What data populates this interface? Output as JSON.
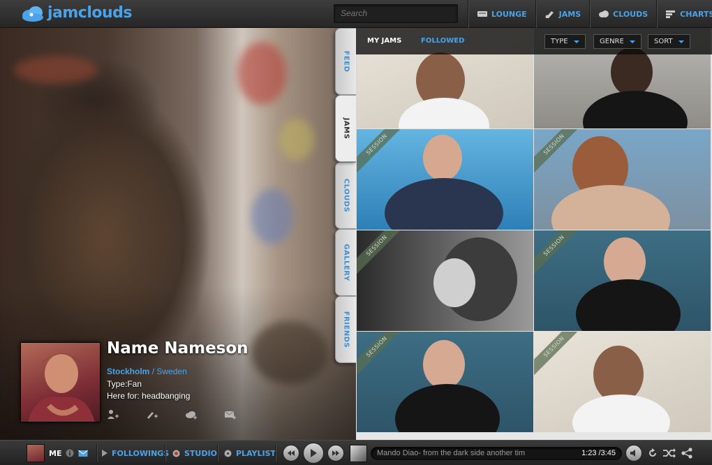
{
  "app": {
    "brand": "jamclouds"
  },
  "search": {
    "placeholder": "Search"
  },
  "nav": [
    {
      "label": "LOUNGE",
      "icon": "lounge-icon"
    },
    {
      "label": "JAMS",
      "icon": "jams-icon"
    },
    {
      "label": "CLOUDS",
      "icon": "cloud-icon"
    },
    {
      "label": "CHARTS",
      "icon": "charts-icon"
    }
  ],
  "profile": {
    "name": "Name Nameson",
    "city": "Stockholm",
    "separator": "/",
    "country": "Sweden",
    "type": "Type:Fan",
    "here_for": "Here for: headbanging"
  },
  "side_tabs": [
    {
      "label": "FEED",
      "active": false
    },
    {
      "label": "JAMS",
      "active": true
    },
    {
      "label": "CLOUDS",
      "active": false
    },
    {
      "label": "GALLERY",
      "active": false
    },
    {
      "label": "FRIENDS",
      "active": false
    }
  ],
  "subnav": {
    "my_jams": "MY JAMS",
    "followed": "FOLLOWED"
  },
  "filters": {
    "type": "TYPE",
    "genre": "GENRE",
    "sort": "SORT"
  },
  "tiles": [
    {
      "ribbon": ""
    },
    {
      "ribbon": ""
    },
    {
      "ribbon": "SESSION"
    },
    {
      "ribbon": "SESSION"
    },
    {
      "ribbon": "SESSION"
    },
    {
      "ribbon": "SESSION"
    },
    {
      "ribbon": "SESSION"
    },
    {
      "ribbon": "SESSION"
    }
  ],
  "bottom": {
    "me": "ME",
    "followings": "FOLLOWINGS",
    "studio": "STUDIO",
    "playlist": "PLAYLIST",
    "track_title": "Mando Diao- from the dark side another tim",
    "track_time": "1:23 /3:45"
  },
  "colors": {
    "accent": "#4aa3e8",
    "bar": "#2b2b2b"
  }
}
